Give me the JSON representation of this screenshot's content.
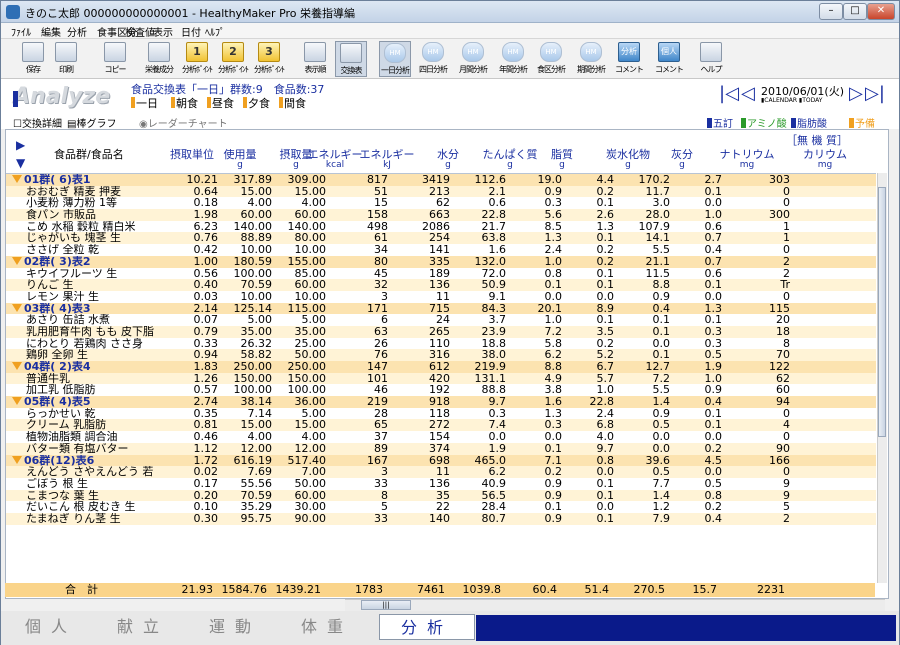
{
  "window": {
    "title": "きのこ太郎 000000000000001 - HealthyMaker Pro 栄養指導編"
  },
  "menu": [
    "ﾌｧｲﾙ",
    "編集",
    "分析",
    "食事区分",
    "検査値",
    "表示",
    "日付",
    "ﾍﾙﾌﾟ"
  ],
  "toolbar": [
    {
      "label": "保存",
      "kind": "plain"
    },
    {
      "label": "印刷",
      "kind": "plain"
    },
    {
      "label": "コピー",
      "kind": "plain"
    },
    {
      "label": "栄養成分",
      "kind": "plain"
    },
    {
      "label": "分析ﾎﾟｲﾝﾄ",
      "kind": "y",
      "num": "1"
    },
    {
      "label": "分析ﾎﾟｲﾝﾄ",
      "kind": "y",
      "num": "2"
    },
    {
      "label": "分析ﾎﾟｲﾝﾄ",
      "kind": "y",
      "num": "3"
    },
    {
      "label": "表示順",
      "kind": "plain"
    },
    {
      "label": "交換表",
      "kind": "plain",
      "active": true
    },
    {
      "label": "一日分析",
      "kind": "g",
      "active": true
    },
    {
      "label": "四日分析",
      "kind": "g"
    },
    {
      "label": "月間分析",
      "kind": "g"
    },
    {
      "label": "年間分析",
      "kind": "g"
    },
    {
      "label": "食区分析",
      "kind": "g"
    },
    {
      "label": "期間分析",
      "kind": "g"
    },
    {
      "label": "コメント",
      "kind": "b",
      "num": "分析"
    },
    {
      "label": "コメント",
      "kind": "b",
      "num": "個人"
    },
    {
      "label": "ヘルプ",
      "kind": "plain"
    }
  ],
  "header": {
    "logo": "Analyze",
    "title": "食品交換表「一日」群数:9　食品数:37",
    "meal_tabs": [
      "一日",
      "朝食",
      "昼食",
      "夕食",
      "間食"
    ],
    "date": "2010/06/01(火)",
    "date_sub": "▮CALENDAR ▮TODAY"
  },
  "options": {
    "exchange_detail": "交換詳細",
    "bar_graph": "棒グラフ",
    "radar": "レーダーチャート"
  },
  "legend": [
    {
      "label": "五訂",
      "color": "#1a2fa0"
    },
    {
      "label": "アミノ酸",
      "color": "#2a9a2a"
    },
    {
      "label": "脂肪酸",
      "color": "#1a2fa0"
    },
    {
      "label": "予備",
      "color": "#f0a020"
    }
  ],
  "columns": {
    "name": "食品群/食品名",
    "inorganic": "［無 機 質］",
    "headers": [
      "摂取単位",
      "使用量",
      "摂取量",
      "エネルギー",
      "エネルギー",
      "水分",
      "たんぱく質",
      "脂質",
      "炭水化物",
      "灰分",
      "ナトリウム",
      "カリウム"
    ],
    "units": [
      "",
      "g",
      "g",
      "kcal",
      "kJ",
      "g",
      "g",
      "g",
      "g",
      "g",
      "mg",
      "mg"
    ]
  },
  "rows": [
    {
      "g": true,
      "n": "01群( 6)表1",
      "v": [
        "10.21",
        "317.89",
        "309.00",
        "817",
        "3419",
        "112.6",
        "19.0",
        "4.4",
        "170.2",
        "2.7",
        "303"
      ]
    },
    {
      "n": "おおむぎ 精麦 押麦",
      "v": [
        "0.64",
        "15.00",
        "15.00",
        "51",
        "213",
        "2.1",
        "0.9",
        "0.2",
        "11.7",
        "0.1",
        "0"
      ]
    },
    {
      "n": "小麦粉 薄力粉 1等",
      "v": [
        "0.18",
        "4.00",
        "4.00",
        "15",
        "62",
        "0.6",
        "0.3",
        "0.1",
        "3.0",
        "0.0",
        "0"
      ]
    },
    {
      "n": "食パン 市販品",
      "v": [
        "1.98",
        "60.00",
        "60.00",
        "158",
        "663",
        "22.8",
        "5.6",
        "2.6",
        "28.0",
        "1.0",
        "300"
      ]
    },
    {
      "n": "こめ 水稲 穀粒 精白米",
      "v": [
        "6.23",
        "140.00",
        "140.00",
        "498",
        "2086",
        "21.7",
        "8.5",
        "1.3",
        "107.9",
        "0.6",
        "1"
      ]
    },
    {
      "n": "じゃがいも 塊茎 生",
      "v": [
        "0.76",
        "88.89",
        "80.00",
        "61",
        "254",
        "63.8",
        "1.3",
        "0.1",
        "14.1",
        "0.7",
        "1"
      ]
    },
    {
      "n": "ささげ 全粒 乾",
      "v": [
        "0.42",
        "10.00",
        "10.00",
        "34",
        "141",
        "1.6",
        "2.4",
        "0.2",
        "5.5",
        "0.4",
        "0"
      ]
    },
    {
      "g": true,
      "n": "02群( 3)表2",
      "v": [
        "1.00",
        "180.59",
        "155.00",
        "80",
        "335",
        "132.0",
        "1.0",
        "0.2",
        "21.1",
        "0.7",
        "2"
      ]
    },
    {
      "n": "キウイフルーツ 生",
      "v": [
        "0.56",
        "100.00",
        "85.00",
        "45",
        "189",
        "72.0",
        "0.8",
        "0.1",
        "11.5",
        "0.6",
        "2"
      ]
    },
    {
      "n": "りんご 生",
      "v": [
        "0.40",
        "70.59",
        "60.00",
        "32",
        "136",
        "50.9",
        "0.1",
        "0.1",
        "8.8",
        "0.1",
        "Tr"
      ]
    },
    {
      "n": "レモン 果汁 生",
      "v": [
        "0.03",
        "10.00",
        "10.00",
        "3",
        "11",
        "9.1",
        "0.0",
        "0.0",
        "0.9",
        "0.0",
        "0"
      ]
    },
    {
      "g": true,
      "n": "03群( 4)表3",
      "v": [
        "2.14",
        "125.14",
        "115.00",
        "171",
        "715",
        "84.3",
        "20.1",
        "8.9",
        "0.4",
        "1.3",
        "115"
      ]
    },
    {
      "n": "あさり 缶詰 水煮",
      "v": [
        "0.07",
        "5.00",
        "5.00",
        "6",
        "24",
        "3.7",
        "1.0",
        "0.1",
        "0.1",
        "0.1",
        "20"
      ]
    },
    {
      "n": "乳用肥育牛肉 もも 皮下脂",
      "v": [
        "0.79",
        "35.00",
        "35.00",
        "63",
        "265",
        "23.9",
        "7.2",
        "3.5",
        "0.1",
        "0.3",
        "18"
      ]
    },
    {
      "n": "にわとり 若鶏肉 ささ身",
      "v": [
        "0.33",
        "26.32",
        "25.00",
        "26",
        "110",
        "18.8",
        "5.8",
        "0.2",
        "0.0",
        "0.3",
        "8"
      ]
    },
    {
      "n": "鶏卵 全卵 生",
      "v": [
        "0.94",
        "58.82",
        "50.00",
        "76",
        "316",
        "38.0",
        "6.2",
        "5.2",
        "0.1",
        "0.5",
        "70"
      ]
    },
    {
      "g": true,
      "n": "04群( 2)表4",
      "v": [
        "1.83",
        "250.00",
        "250.00",
        "147",
        "612",
        "219.9",
        "8.8",
        "6.7",
        "12.7",
        "1.9",
        "122"
      ]
    },
    {
      "n": "普通牛乳",
      "v": [
        "1.26",
        "150.00",
        "150.00",
        "101",
        "420",
        "131.1",
        "4.9",
        "5.7",
        "7.2",
        "1.0",
        "62"
      ]
    },
    {
      "n": "加工乳 低脂肪",
      "v": [
        "0.57",
        "100.00",
        "100.00",
        "46",
        "192",
        "88.8",
        "3.8",
        "1.0",
        "5.5",
        "0.9",
        "60"
      ]
    },
    {
      "g": true,
      "n": "05群( 4)表5",
      "v": [
        "2.74",
        "38.14",
        "36.00",
        "219",
        "918",
        "9.7",
        "1.6",
        "22.8",
        "1.4",
        "0.4",
        "94"
      ]
    },
    {
      "n": "らっかせい 乾",
      "v": [
        "0.35",
        "7.14",
        "5.00",
        "28",
        "118",
        "0.3",
        "1.3",
        "2.4",
        "0.9",
        "0.1",
        "0"
      ]
    },
    {
      "n": "クリーム 乳脂肪",
      "v": [
        "0.81",
        "15.00",
        "15.00",
        "65",
        "272",
        "7.4",
        "0.3",
        "6.8",
        "0.5",
        "0.1",
        "4"
      ]
    },
    {
      "n": "植物油脂類 調合油",
      "v": [
        "0.46",
        "4.00",
        "4.00",
        "37",
        "154",
        "0.0",
        "0.0",
        "4.0",
        "0.0",
        "0.0",
        "0"
      ]
    },
    {
      "n": "バター類 有塩バター",
      "v": [
        "1.12",
        "12.00",
        "12.00",
        "89",
        "374",
        "1.9",
        "0.1",
        "9.7",
        "0.0",
        "0.2",
        "90"
      ]
    },
    {
      "g": true,
      "n": "06群(12)表6",
      "v": [
        "1.72",
        "616.19",
        "517.40",
        "167",
        "698",
        "465.0",
        "7.1",
        "0.8",
        "39.6",
        "4.5",
        "166"
      ]
    },
    {
      "n": "えんどう さやえんどう 若",
      "v": [
        "0.02",
        "7.69",
        "7.00",
        "3",
        "11",
        "6.2",
        "0.2",
        "0.0",
        "0.5",
        "0.0",
        "0"
      ]
    },
    {
      "n": "ごぼう 根 生",
      "v": [
        "0.17",
        "55.56",
        "50.00",
        "33",
        "136",
        "40.9",
        "0.9",
        "0.1",
        "7.7",
        "0.5",
        "9"
      ]
    },
    {
      "n": "こまつな 葉 生",
      "v": [
        "0.20",
        "70.59",
        "60.00",
        "8",
        "35",
        "56.5",
        "0.9",
        "0.1",
        "1.4",
        "0.8",
        "9"
      ]
    },
    {
      "n": "だいこん 根 皮むき 生",
      "v": [
        "0.10",
        "35.29",
        "30.00",
        "5",
        "22",
        "28.4",
        "0.1",
        "0.0",
        "1.2",
        "0.2",
        "5"
      ]
    },
    {
      "n": "たまねぎ りん茎 生",
      "v": [
        "0.30",
        "95.75",
        "90.00",
        "33",
        "140",
        "80.7",
        "0.9",
        "0.1",
        "7.9",
        "0.4",
        "2"
      ]
    }
  ],
  "total": {
    "label": "合　計",
    "v": [
      "21.93",
      "1584.76",
      "1439.21",
      "1783",
      "7461",
      "1039.8",
      "60.4",
      "51.4",
      "270.5",
      "15.7",
      "2231"
    ]
  },
  "bottom_tabs": [
    "個人",
    "献立",
    "運動",
    "体重",
    "分析"
  ]
}
